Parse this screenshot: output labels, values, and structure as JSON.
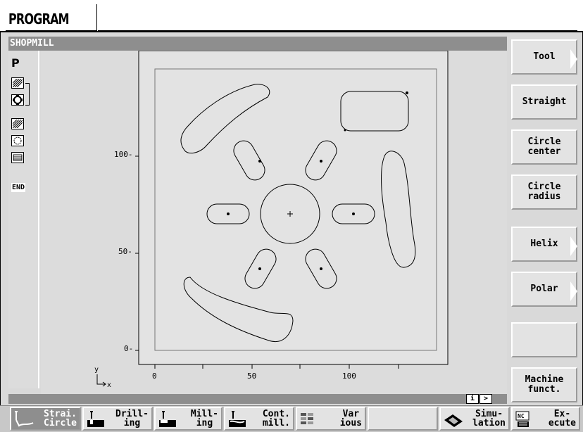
{
  "header": {
    "title": "PROGRAM"
  },
  "mode_bar": {
    "label": "SHOPMILL"
  },
  "left_strip": {
    "p_label": "P",
    "icons": [
      "milling-pattern-icon",
      "contour-icon",
      "milling-pattern-icon",
      "circle-contour-icon",
      "rectangle-pocket-icon"
    ],
    "end_label": "END"
  },
  "graphic": {
    "x_ticks": [
      "0",
      "50",
      "100"
    ],
    "y_ticks": [
      "0-",
      "50-",
      "100-"
    ],
    "axis_x_label": "x",
    "axis_y_label": "y"
  },
  "info_buttons": [
    "i",
    ">"
  ],
  "vertical_softkeys": [
    {
      "label": "Tool",
      "arrow": true
    },
    {
      "label": "Straight",
      "arrow": false
    },
    {
      "label": "Circle\ncenter",
      "arrow": false
    },
    {
      "label": "Circle\nradius",
      "arrow": false
    },
    {
      "label": "Helix",
      "arrow": true
    },
    {
      "label": "Polar",
      "arrow": true
    },
    {
      "label": "",
      "arrow": false
    },
    {
      "label": "Machine\nfunct.",
      "arrow": false
    }
  ],
  "horizontal_softkeys": [
    {
      "label": "Strai.\nCircle",
      "icon": "contour-path-icon",
      "selected": true
    },
    {
      "label": "Drill-\ning",
      "icon": "drilling-icon",
      "selected": false
    },
    {
      "label": "Mill-\ning",
      "icon": "milling-icon",
      "selected": false
    },
    {
      "label": "Cont.\nmill.",
      "icon": "contour-milling-icon",
      "selected": false
    },
    {
      "label": "Var\nious",
      "icon": "various-icon",
      "selected": false
    },
    {
      "label": "",
      "icon": "",
      "selected": false
    },
    {
      "label": "Simu-\nlation",
      "icon": "simulation-icon",
      "selected": false
    },
    {
      "label": "Ex-\necute",
      "icon": "nc-execute-icon",
      "selected": false
    }
  ],
  "colors": {
    "panel": "#d9d9d9",
    "bar": "#8e8e8e",
    "key": "#e3e3e3"
  }
}
